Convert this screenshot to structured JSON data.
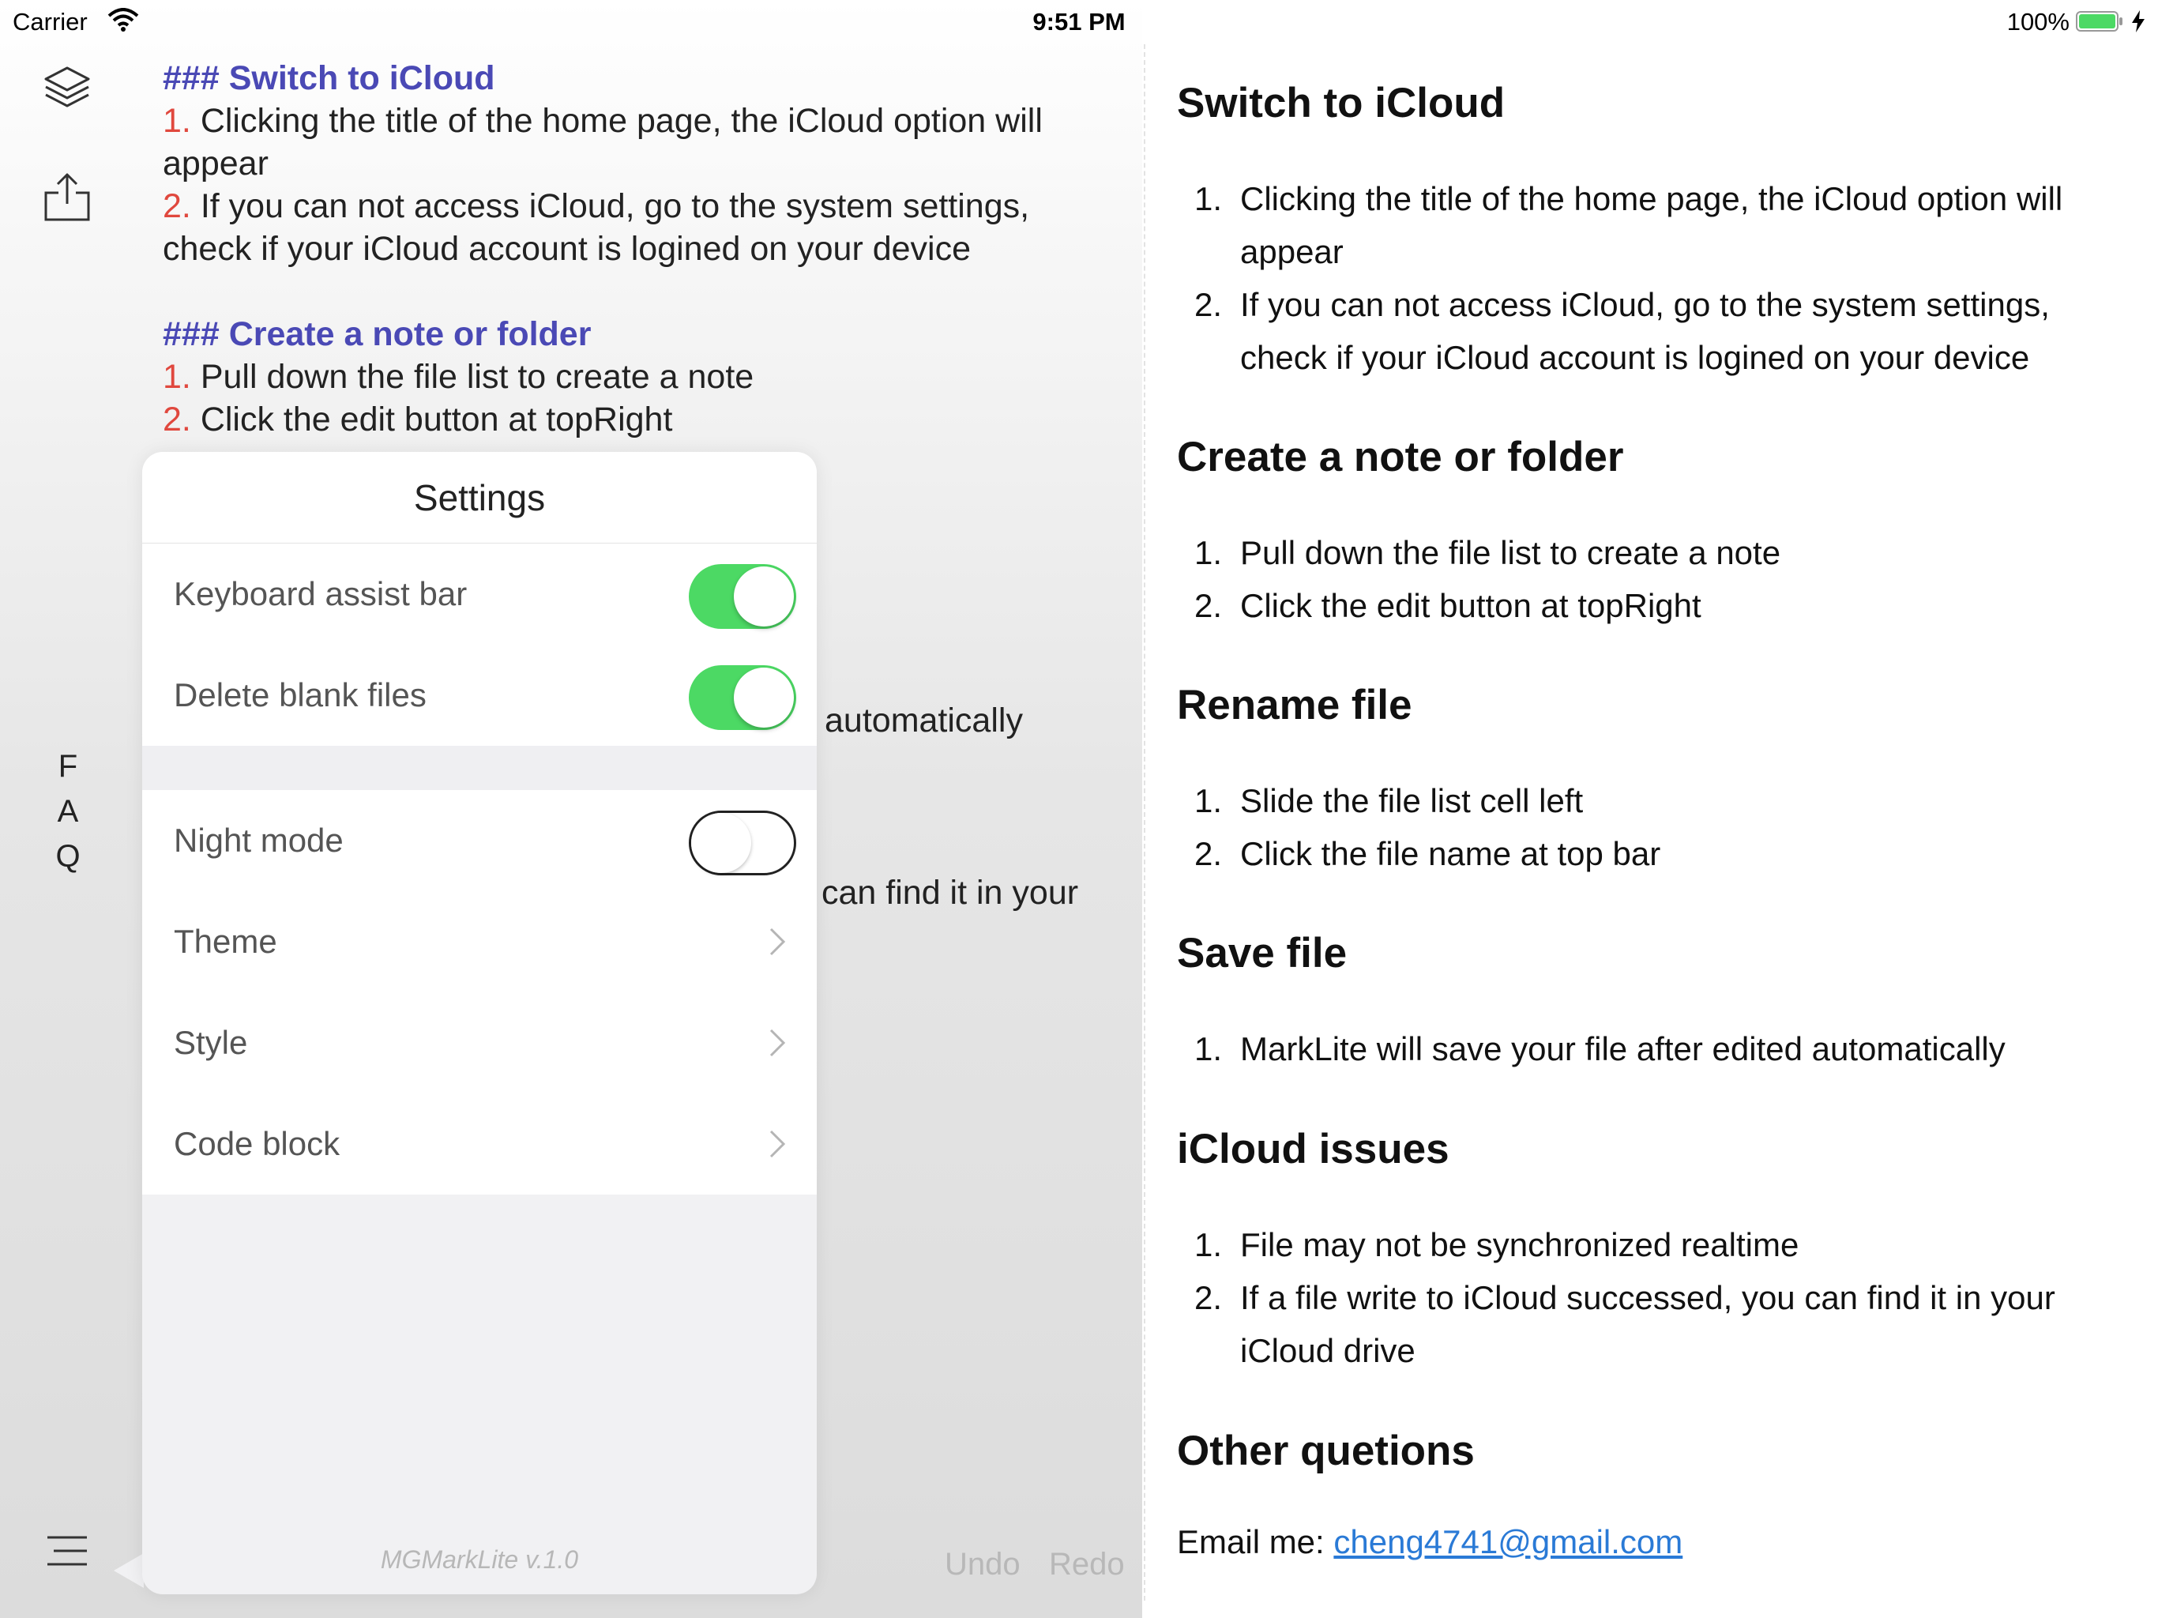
{
  "status_bar": {
    "carrier": "Carrier",
    "time": "9:51 PM",
    "battery": "100%",
    "battery_color": "#4cd964"
  },
  "editor": {
    "rail_icons": [
      "layers-icon",
      "share-icon",
      "menu-icon"
    ],
    "faq_letters": [
      "F",
      "A",
      "Q"
    ],
    "lines": {
      "h1": "### Switch to iCloud",
      "s1_n1": "1.",
      "s1_t1": "Clicking the title of the home page, the iCloud option will appear",
      "s1_n2": "2.",
      "s1_t2": "If you can not access iCloud, go to the system settings, check if your iCloud account is logined on your device",
      "h2": "### Create a note or folder",
      "s2_n1": "1.",
      "s2_t1": "Pull down the file list to create a note",
      "s2_n2": "2.",
      "s2_t2": "Click the edit button at topRight"
    },
    "peek_1": "automatically",
    "peek_2": "can find it in your",
    "undo": "Undo",
    "redo": "Redo",
    "heading_color": "#4a49b5",
    "number_color": "#e0483e"
  },
  "settings": {
    "title": "Settings",
    "keyboard_assist_bar": {
      "label": "Keyboard assist bar",
      "on": true
    },
    "delete_blank_files": {
      "label": "Delete blank files",
      "on": true
    },
    "night_mode": {
      "label": "Night mode",
      "on": false
    },
    "theme": "Theme",
    "style": "Style",
    "code_block": "Code block",
    "version": "MGMarkLite v.1.0",
    "toggle_on_color": "#4cd964"
  },
  "preview": {
    "sections": {
      "s1": {
        "title": "Switch to iCloud",
        "items": [
          "Clicking the title of the home page, the iCloud option will appear",
          "If you can not access iCloud, go to the system settings, check if your iCloud account is logined on your device"
        ]
      },
      "s2": {
        "title": "Create a note or folder",
        "items": [
          "Pull down the file list to create a note",
          "Click the edit button at topRight"
        ]
      },
      "s3": {
        "title": "Rename file",
        "items": [
          "Slide the file list cell left",
          "Click the file name at top bar"
        ]
      },
      "s4": {
        "title": "Save file",
        "items": [
          "MarkLite will save your file after edited automatically"
        ]
      },
      "s5": {
        "title": "iCloud issues",
        "items": [
          "File may not be synchronized realtime",
          "If a file write to iCloud successed, you can find it in your iCloud drive"
        ]
      },
      "s6": {
        "title": "Other quetions"
      }
    },
    "item_numbers": [
      "1.",
      "2."
    ],
    "email_label": "Email me: ",
    "email": "cheng4741@gmail.com",
    "link_color": "#2a7ad6"
  }
}
